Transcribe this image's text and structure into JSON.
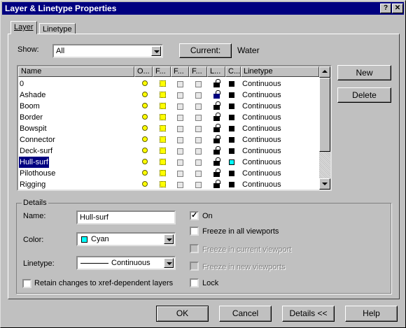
{
  "window": {
    "title": "Layer & Linetype Properties",
    "help_btn": "?",
    "close_btn": "✕"
  },
  "tabs": [
    {
      "label": "Layer"
    },
    {
      "label": "Linetype"
    }
  ],
  "show": {
    "label": "Show:",
    "value": "All"
  },
  "current": {
    "button": "Current:",
    "value": "Water"
  },
  "columns": [
    "Name",
    "O...",
    "F...",
    "F...",
    "F...",
    "L...",
    "C...",
    "Linetype"
  ],
  "layers": [
    {
      "name": "0",
      "color": "#000000",
      "linetype": "Continuous",
      "locked": false,
      "selected": false
    },
    {
      "name": "Ashade",
      "color": "#000000",
      "linetype": "Continuous",
      "locked": true,
      "selected": false
    },
    {
      "name": "Boom",
      "color": "#000000",
      "linetype": "Continuous",
      "locked": false,
      "selected": false
    },
    {
      "name": "Border",
      "color": "#000000",
      "linetype": "Continuous",
      "locked": false,
      "selected": false
    },
    {
      "name": "Bowspit",
      "color": "#000000",
      "linetype": "Continuous",
      "locked": false,
      "selected": false
    },
    {
      "name": "Connector",
      "color": "#000000",
      "linetype": "Continuous",
      "locked": false,
      "selected": false
    },
    {
      "name": "Deck-surf",
      "color": "#000000",
      "linetype": "Continuous",
      "locked": false,
      "selected": false
    },
    {
      "name": "Hull-surf",
      "color": "#00ffff",
      "linetype": "Continuous",
      "locked": false,
      "selected": true
    },
    {
      "name": "Pilothouse",
      "color": "#000000",
      "linetype": "Continuous",
      "locked": false,
      "selected": false
    },
    {
      "name": "Rigging",
      "color": "#000000",
      "linetype": "Continuous",
      "locked": false,
      "selected": false
    }
  ],
  "side_buttons": {
    "new": "New",
    "delete": "Delete"
  },
  "details": {
    "group_label": "Details",
    "name_label": "Name:",
    "name_value": "Hull-surf",
    "color_label": "Color:",
    "color_value": "Cyan",
    "color_hex": "#00ffff",
    "linetype_label": "Linetype:",
    "linetype_value": "Continuous",
    "retain_label": "Retain changes to xref-dependent layers",
    "on_label": "On",
    "freeze_all_label": "Freeze in all viewports",
    "freeze_current_label": "Freeze in current viewport",
    "freeze_new_label": "Freeze in new viewports",
    "lock_label": "Lock"
  },
  "footer": {
    "ok": "OK",
    "cancel": "Cancel",
    "details": "Details <<",
    "help": "Help"
  }
}
